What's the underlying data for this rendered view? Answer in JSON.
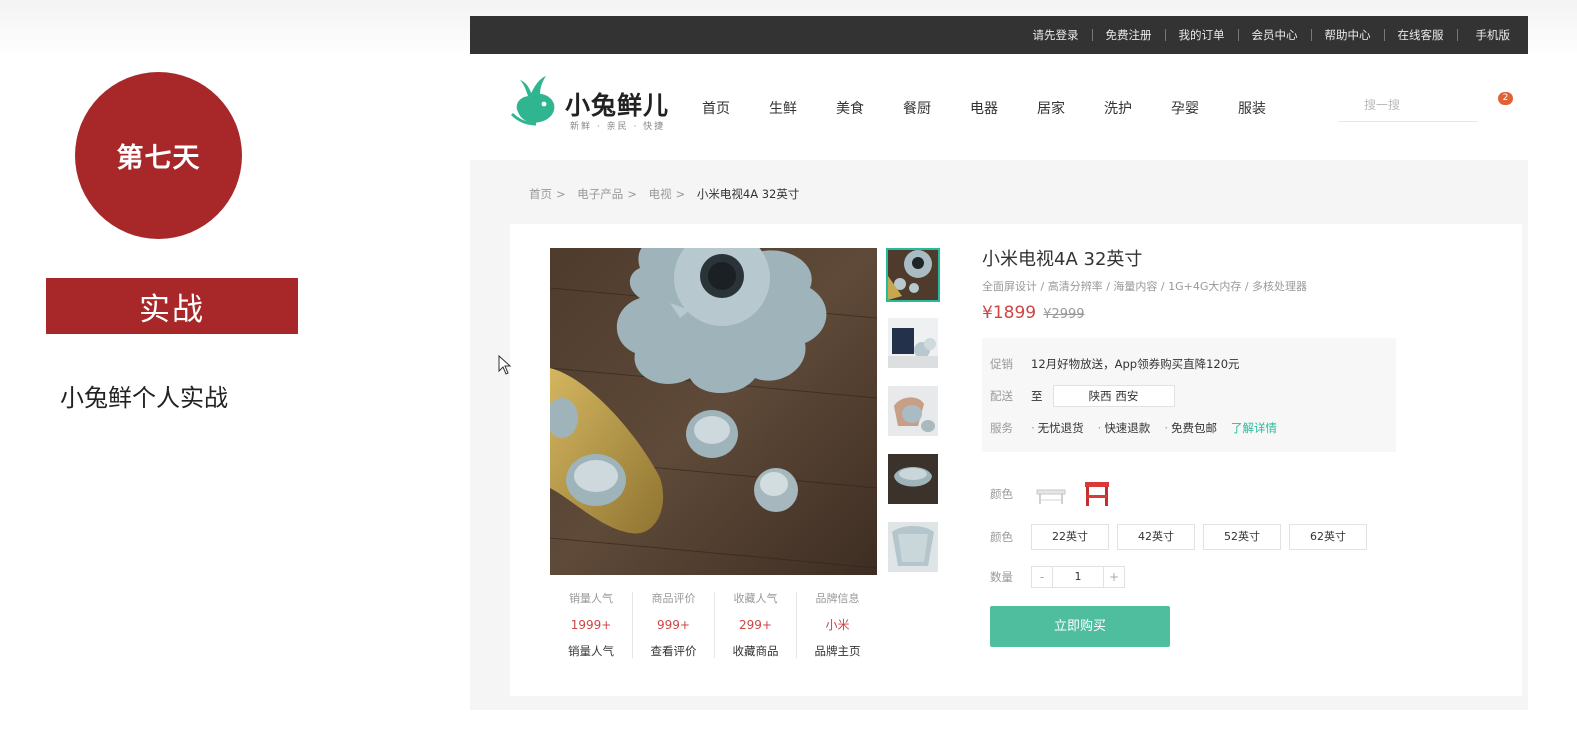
{
  "slide": {
    "day_badge": "第七天",
    "section_banner": "实战",
    "subtitle": "小兔鲜个人实战"
  },
  "topbar": {
    "links": [
      "请先登录",
      "免费注册",
      "我的订单",
      "会员中心",
      "帮助中心",
      "在线客服"
    ],
    "mobile": "手机版"
  },
  "header": {
    "logo_name": "小兔鲜儿",
    "logo_slogan": "新鲜 · 亲民 · 快捷",
    "nav": [
      "首页",
      "生鲜",
      "美食",
      "餐厨",
      "电器",
      "居家",
      "洗护",
      "孕婴",
      "服装"
    ],
    "search_placeholder": "搜一搜",
    "cart_count": "2"
  },
  "breadcrumb": {
    "items": [
      "首页",
      "电子产品",
      "电视"
    ],
    "separator": ">",
    "current": "小米电视4A 32英寸"
  },
  "goods": {
    "name": "小米电视4A 32英寸",
    "desc": "全面屏设计 / 高清分辨率 / 海量内容 / 1G+4G大内存 / 多核处理器",
    "price": "¥1899",
    "old_price": "¥2999",
    "promo_label": "促销",
    "promo_text": "12月好物放送，App领券购买直降120元",
    "delivery_label": "配送",
    "delivery_to": "至",
    "delivery_region": "陕西 西安",
    "service_label": "服务",
    "services": [
      "无忧退货",
      "快速退款",
      "免费包邮"
    ],
    "service_link": "了解详情",
    "color_label": "颜色",
    "size_label": "颜色",
    "sizes": [
      "22英寸",
      "42英寸",
      "52英寸",
      "62英寸"
    ],
    "qty_label": "数量",
    "qty_minus": "-",
    "qty_value": "1",
    "qty_plus": "+",
    "buy_label": "立即购买"
  },
  "stats": [
    {
      "label": "销量人气",
      "value": "1999+",
      "link": "销量人气"
    },
    {
      "label": "商品评价",
      "value": "999+",
      "link": "查看评价"
    },
    {
      "label": "收藏人气",
      "value": "299+",
      "link": "收藏商品"
    },
    {
      "label": "品牌信息",
      "value": "小米",
      "link": "品牌主页"
    }
  ],
  "colors": {
    "accent": "#27ba9b",
    "buy_button": "#4fbe9f",
    "price": "#cf4444",
    "slide_red": "#a8282a",
    "topbar": "#333333",
    "badge": "#e26237"
  },
  "icons": {
    "search": "search-icon",
    "cart": "cart-icon",
    "cursor": "mouse-cursor-icon"
  }
}
